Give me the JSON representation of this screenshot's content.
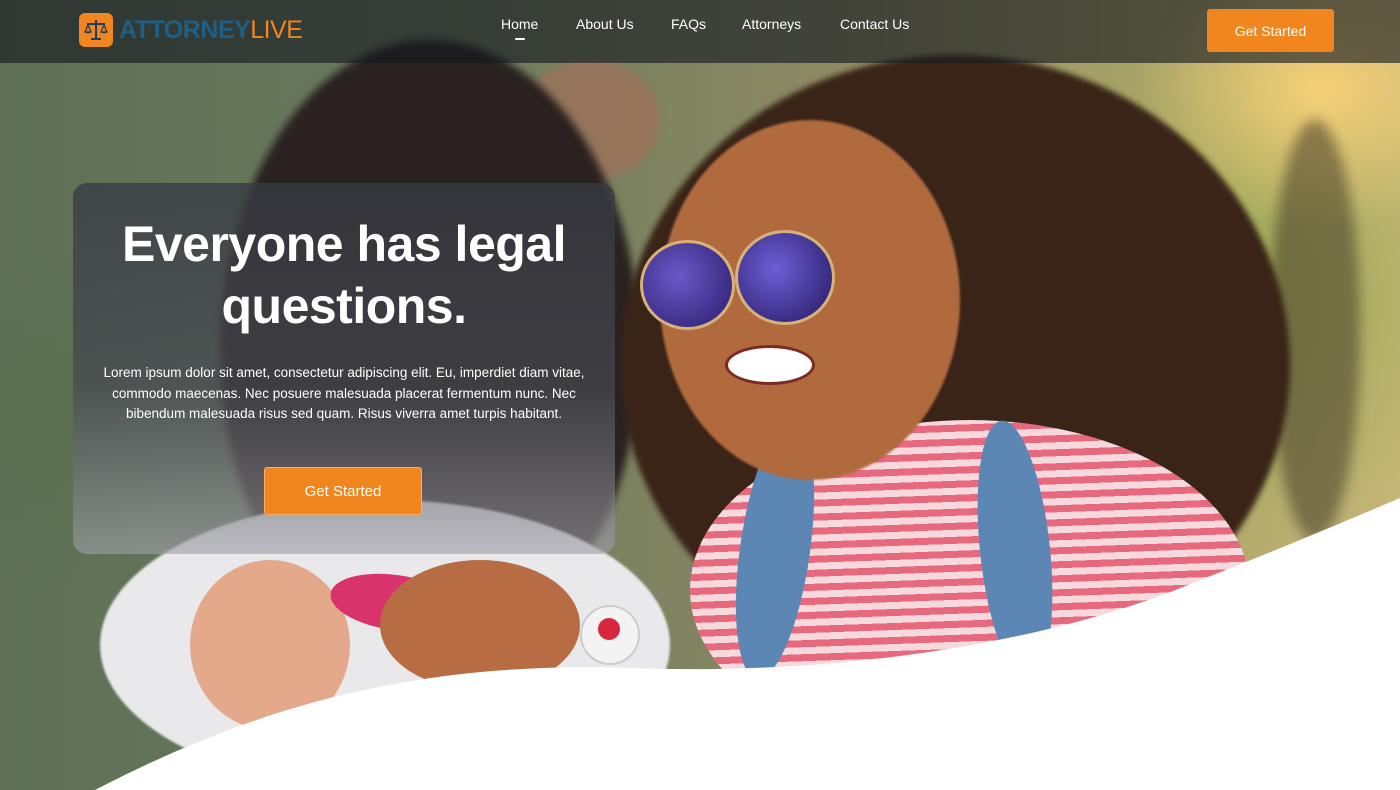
{
  "brand": {
    "logo_text_part1": "ATTORNEY",
    "logo_text_part2": "LIVE",
    "logo_icon": "scales-of-justice-icon",
    "primary_color": "#f0861d",
    "secondary_color": "#1f5f86"
  },
  "nav": {
    "items": [
      {
        "label": "Home",
        "active": true
      },
      {
        "label": "About Us",
        "active": false
      },
      {
        "label": "FAQs",
        "active": false
      },
      {
        "label": "Attorneys",
        "active": false
      },
      {
        "label": "Contact Us",
        "active": false
      }
    ],
    "cta_label": "Get Started"
  },
  "hero": {
    "title": "Everyone has legal questions.",
    "body": "Lorem ipsum dolor sit amet, consectetur adipiscing elit. Eu, imperdiet diam vitae, commodo maecenas. Nec posuere malesuada placerat fermentum nunc. Nec bibendum malesuada risus sed quam. Risus viverra amet turpis habitant.",
    "cta_label": "Get Started"
  }
}
